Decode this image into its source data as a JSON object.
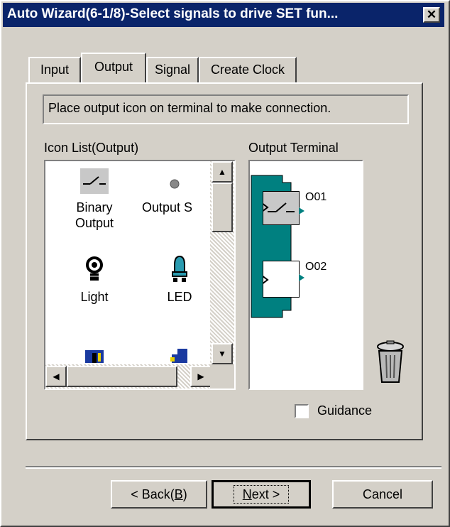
{
  "window": {
    "title": "Auto Wizard(6-1/8)-Select signals to drive SET fun...",
    "close_symbol": "✕"
  },
  "tabs": [
    {
      "label": "Input"
    },
    {
      "label": "Output",
      "active": true
    },
    {
      "label": "Signal"
    },
    {
      "label": "Create Clock"
    }
  ],
  "instruction": "Place output icon on terminal to make connection.",
  "icon_list": {
    "label": "Icon List(Output)",
    "items": [
      {
        "label": "Binary",
        "label2": "Output",
        "icon": "switch-icon"
      },
      {
        "label": "Output S",
        "label2": "",
        "icon": "dot-icon"
      },
      {
        "label": "Light",
        "label2": "",
        "icon": "bulb-icon"
      },
      {
        "label": "LED",
        "label2": "",
        "icon": "led-icon"
      },
      {
        "label": "",
        "label2": "",
        "icon": "panel-icon"
      },
      {
        "label": "",
        "label2": "",
        "icon": "device-icon"
      }
    ]
  },
  "output_terminal": {
    "label": "Output Terminal",
    "terminals": [
      {
        "name": "O01",
        "icon": "switch-icon"
      },
      {
        "name": "O02",
        "icon": "empty-slot"
      }
    ]
  },
  "guidance": {
    "label": "Guidance",
    "checked": false
  },
  "buttons": {
    "back": {
      "text": "< Back(",
      "accel": "B",
      "tail": ")"
    },
    "next": {
      "accel": "N",
      "text": "ext >"
    },
    "cancel": "Cancel"
  },
  "colors": {
    "titlebar": "#0a246a",
    "terminal_bar": "#008080",
    "face": "#d4d0c8"
  }
}
